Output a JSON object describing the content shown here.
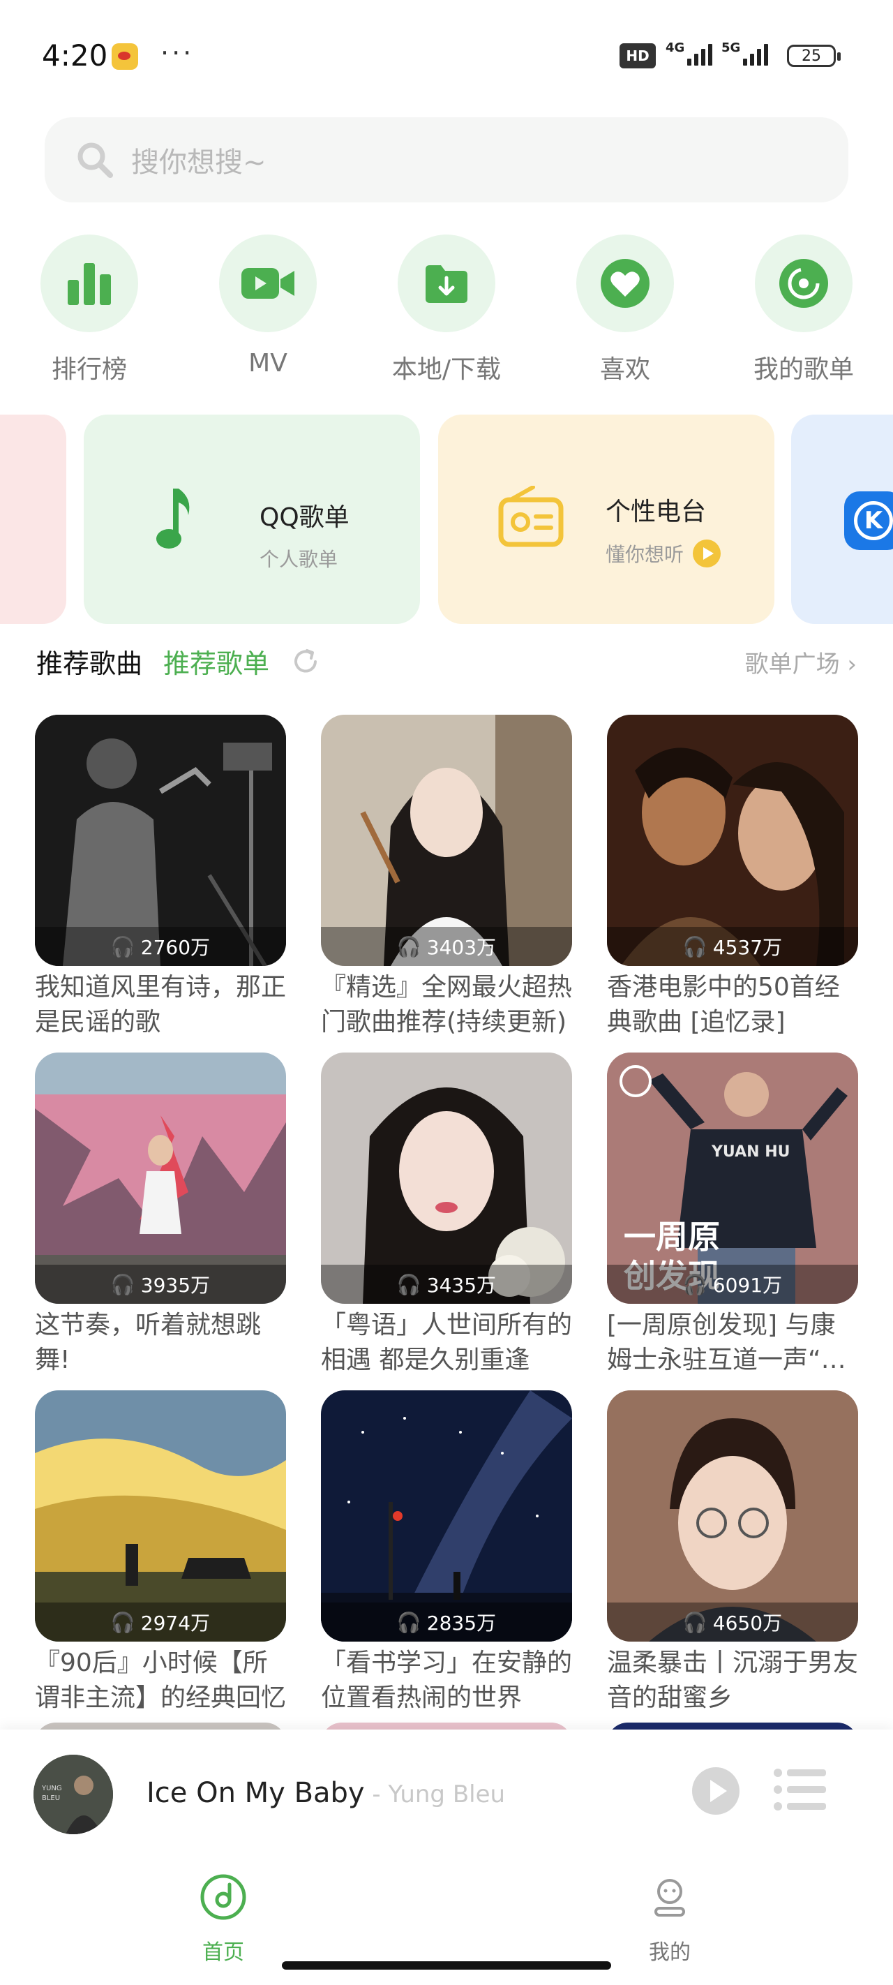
{
  "status_bar": {
    "time": "4:20",
    "dots": "···",
    "hd": "HD",
    "net1": "4G",
    "net2": "5G",
    "battery": "25"
  },
  "search": {
    "placeholder": "搜你想搜~"
  },
  "quick_links": [
    {
      "label": "排行榜",
      "icon": "chart-bars-icon"
    },
    {
      "label": "MV",
      "icon": "video-camera-icon"
    },
    {
      "label": "本地/下载",
      "icon": "download-folder-icon"
    },
    {
      "label": "喜欢",
      "icon": "heart-icon"
    },
    {
      "label": "我的歌单",
      "icon": "playlist-disc-icon"
    }
  ],
  "feature_cards": [
    {
      "title": "QQ歌单",
      "subtitle": "个人歌单",
      "icon": "music-note-icon",
      "bg": "#e8f6ea",
      "accent": "#3aa54a"
    },
    {
      "title": "个性电台",
      "subtitle": "懂你想听",
      "icon": "radio-icon",
      "bg": "#fdf2da",
      "accent": "#f3c43a"
    }
  ],
  "tabs": {
    "songs": "推荐歌曲",
    "playlists": "推荐歌单",
    "plaza": "歌单广场"
  },
  "playlists": [
    {
      "title": "我知道风里有诗，那正是民谣的歌",
      "count": "2760万"
    },
    {
      "title": "『精选』全网最火超热门歌曲推荐(持续更新)",
      "count": "3403万"
    },
    {
      "title": "香港电影中的50首经典歌曲 [追忆录]",
      "count": "4537万"
    },
    {
      "title": "这节奏，听着就想跳舞!",
      "count": "3935万"
    },
    {
      "title": "「粤语」人世间所有的相遇 都是久别重逢",
      "count": "3435万"
    },
    {
      "title": "[一周原创发现] 与康姆士永驻互道一声“晚安”",
      "count": "6091万",
      "overlay": "一周原创发现",
      "tshirt": "YUAN HU"
    },
    {
      "title": "『90后』小时候【所谓非主流】的经典回忆",
      "count": "2974万"
    },
    {
      "title": "「看书学习」在安静的位置看热闹的世界",
      "count": "2835万"
    },
    {
      "title": "温柔暴击丨沉溺于男友音的甜蜜乡",
      "count": "4650万"
    }
  ],
  "player": {
    "song": "Ice On My Baby",
    "artist": "Yung Bleu",
    "separator": " - ",
    "cover_text": "YUNG BLEU"
  },
  "nav": {
    "home": "首页",
    "mine": "我的"
  },
  "colors": {
    "accent": "#4caf50",
    "light_green": "#e8f6ea"
  }
}
